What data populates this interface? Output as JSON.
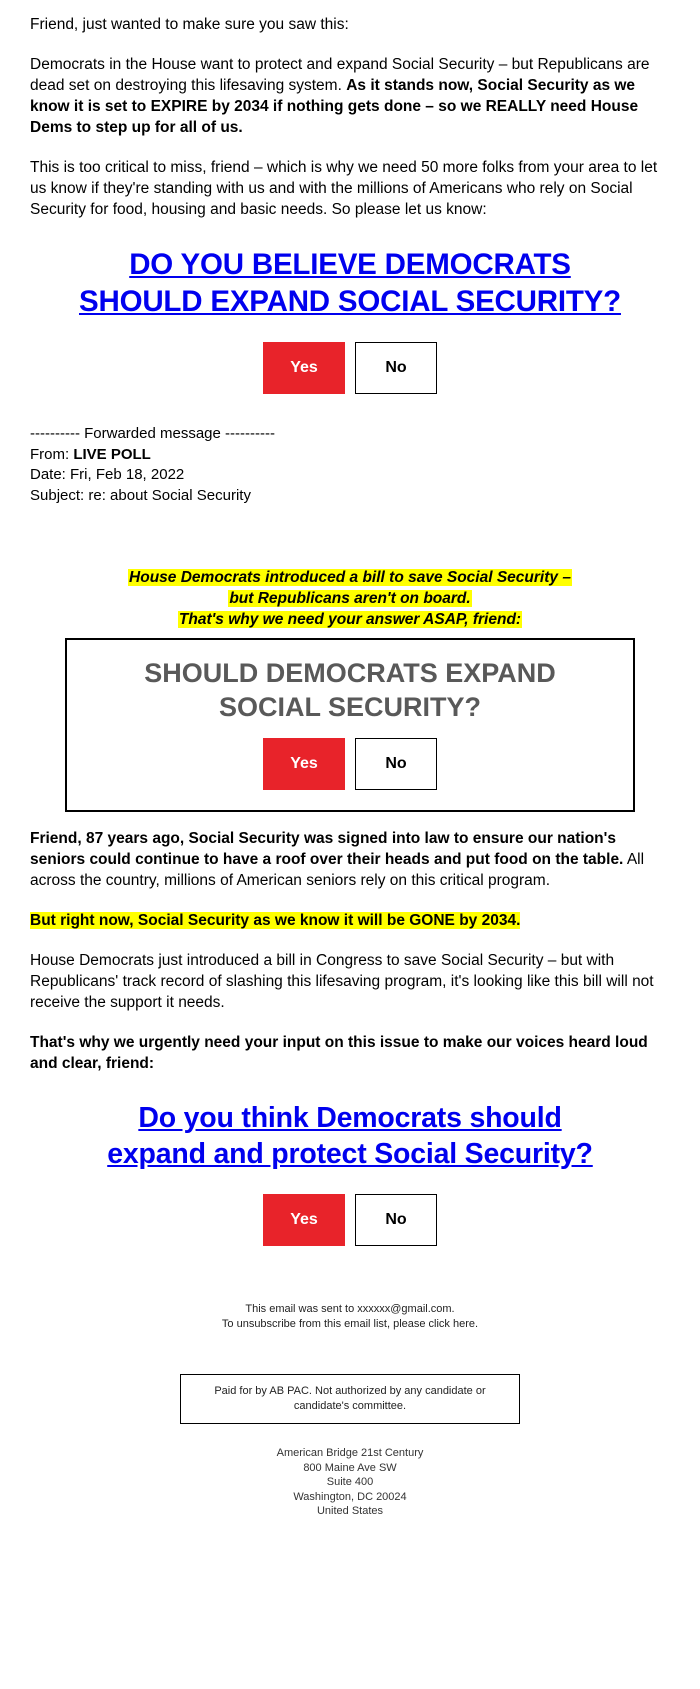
{
  "colors": {
    "link_blue": "#0000ee",
    "yes_red": "#e8232a",
    "highlight_yellow": "#ffff00",
    "poll_question_gray": "#595959"
  },
  "intro": {
    "greeting": "Friend, just wanted to make sure you saw this:",
    "para2_plain_a": "Democrats in the House want to protect and expand Social Security – but Republicans are dead set on destroying this lifesaving system. ",
    "para2_bold": "As it stands now, Social Security as we know it is set to EXPIRE by 2034 if nothing gets done – so we REALLY need House Dems to step up for all of us.",
    "para3": "This is too critical to miss, friend – which is why we need 50 more folks from your area to let us know if they're standing with us and with the millions of Americans who rely on Social Security for food, housing and basic needs. So please let us know:"
  },
  "headline_top": {
    "line1": "DO YOU BELIEVE DEMOCRATS",
    "line2": "SHOULD EXPAND SOCIAL SECURITY?"
  },
  "poll_top": {
    "yes_label": "Yes",
    "no_label": "No"
  },
  "forwarded": {
    "divider": "---------- Forwarded message ----------",
    "from_label": "From: ",
    "from_value": "LIVE POLL",
    "date_line": "Date: Fri, Feb 18, 2022",
    "subject_line": "Subject: re: about Social Security"
  },
  "promo": {
    "line1": "House Democrats introduced a bill to save Social Security –",
    "line2": "but Republicans aren't on board.",
    "line3": "That's why we need your answer ASAP, friend:"
  },
  "poll_box": {
    "question_line1": "SHOULD DEMOCRATS EXPAND",
    "question_line2": "SOCIAL SECURITY?",
    "yes_label": "Yes",
    "no_label": "No"
  },
  "body": {
    "p1_bold": "Friend, 87 years ago, Social Security was signed into law to ensure our nation's seniors could continue to have a roof over their heads and put food on the table.",
    "p1_plain": " All across the country, millions of American seniors rely on this critical program.",
    "p2_highlight": "But right now, Social Security as we know it will be GONE by 2034.",
    "p3": "House Democrats just introduced a bill in Congress to save Social Security – but with Republicans' track record of slashing this lifesaving program, it's looking like this bill will not receive the support it needs.",
    "p4_bold": "That's why we urgently need your input on this issue to make our voices heard loud and clear, friend:"
  },
  "headline_bottom": {
    "line1": "Do you think Democrats should",
    "line2": "expand and protect Social Security?"
  },
  "poll_bottom": {
    "yes_label": "Yes",
    "no_label": "No"
  },
  "footer": {
    "sent_to": "This email was sent to xxxxxx@gmail.com.",
    "unsubscribe": "To unsubscribe from this email list, please click here.",
    "paid_for_line1": "Paid for by AB PAC. Not authorized by any candidate or",
    "paid_for_line2": "candidate's committee.",
    "org": "American Bridge 21st Century",
    "street": "800 Maine Ave SW",
    "suite": "Suite 400",
    "city": "Washington, DC 20024",
    "country": "United States"
  }
}
